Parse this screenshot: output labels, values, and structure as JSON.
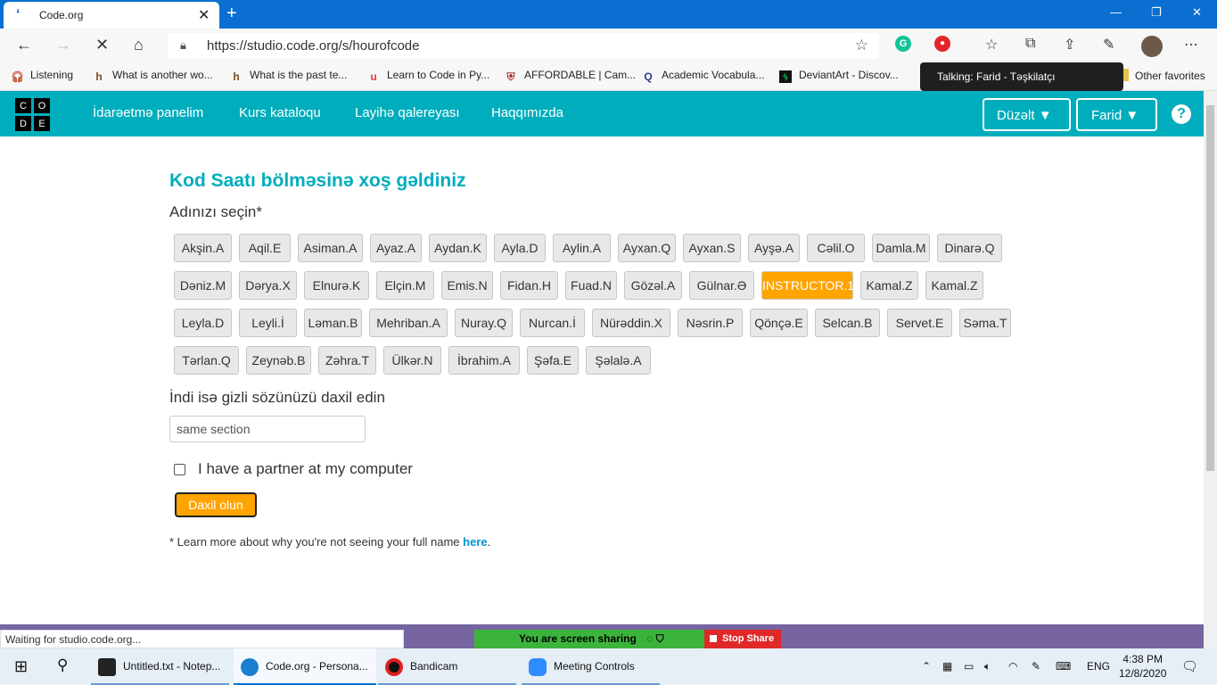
{
  "browser": {
    "tab_title": "Code.org",
    "tab_close": "✕",
    "new_tab": "+",
    "url": "https://studio.code.org/s/hourofcode",
    "status_text": "Waiting for studio.code.org...",
    "bookmarks": [
      {
        "label": "Listening",
        "icon": "headphones-icon"
      },
      {
        "label": "What is another wo...",
        "icon": "h-icon"
      },
      {
        "label": "What is the past te...",
        "icon": "h-icon"
      },
      {
        "label": "Learn to Code in Py...",
        "icon": "u-icon"
      },
      {
        "label": "AFFORDABLE | Cam...",
        "icon": "shield-icon"
      },
      {
        "label": "Academic Vocabula...",
        "icon": "q-icon"
      },
      {
        "label": "DeviantArt - Discov...",
        "icon": "deviantart-icon"
      }
    ],
    "other_favorites": "Other favorites",
    "tooltip": "Talking: Farid - Təşkilatçı"
  },
  "site": {
    "logo_letters": [
      "C",
      "O",
      "D",
      "E"
    ],
    "nav": [
      "İdarəetmə panelim",
      "Kurs kataloqu",
      "Layihə qalereyası",
      "Haqqımızda"
    ],
    "edit_button": "Düzəlt",
    "user_button": "Farid",
    "help": "?"
  },
  "main": {
    "heading": "Kod Saatı bölməsinə xoş gəldiniz",
    "choose_name": "Adınızı seçin*",
    "names": [
      [
        "Akşin.A",
        "Aqil.E",
        "Asiman.A",
        "Ayaz.A",
        "Aydan.K",
        "Ayla.D",
        "Aylin.A",
        "Ayxan.Q",
        "Ayxan.S",
        "Ayşə.A",
        "Cəlil.O",
        "Damla.M",
        "Dinarə.Q"
      ],
      [
        "Dəniz.M",
        "Dərya.X",
        "Elnurə.K",
        "Elçin.M",
        "Emis.N",
        "Fidan.H",
        "Fuad.N",
        "Gözəl.A",
        "Gülnar.Ə",
        "INSTRUCTOR.1",
        "Kamal.Z",
        "Kamal.Z"
      ],
      [
        "Leyla.D",
        "Leyli.İ",
        "Ləman.B",
        "Mehriban.A",
        "Nuray.Q",
        "Nurcan.İ",
        "Nürəddin.X",
        "Nəsrin.P",
        "Qönçə.E",
        "Selcan.B",
        "Servet.E",
        "Səma.T"
      ],
      [
        "Tərlan.Q",
        "Zeynəb.B",
        "Zəhra.T",
        "Ülkər.N",
        "İbrahim.A",
        "Şəfa.E",
        "Şəlalə.A"
      ]
    ],
    "selected_name": "INSTRUCTOR.1",
    "secret_prompt": "İndi isə gizli sözünüzü daxil edin",
    "secret_value": "same section",
    "partner_label": "I have a partner at my computer",
    "partner_checked": false,
    "submit_label": "Daxil olun",
    "note_prefix": "* Learn more about why you're not seeing your full name",
    "note_link": "here",
    "note_suffix": "."
  },
  "zoom": {
    "sharing_text": "You are screen sharing",
    "stop_share": "Stop Share"
  },
  "taskbar": {
    "items": [
      {
        "label": "Untitled.txt - Notep...",
        "icon": "notepad-icon"
      },
      {
        "label": "Code.org - Persona...",
        "icon": "edge-icon"
      },
      {
        "label": "Bandicam",
        "icon": "bandicam-icon"
      },
      {
        "label": "Meeting Controls",
        "icon": "zoom-icon"
      }
    ],
    "language": "ENG",
    "time": "4:38 PM",
    "date": "12/8/2020"
  },
  "colors": {
    "accent": "#00adbc",
    "selected": "#ffa400",
    "browser_blue": "#0b6fd1"
  }
}
